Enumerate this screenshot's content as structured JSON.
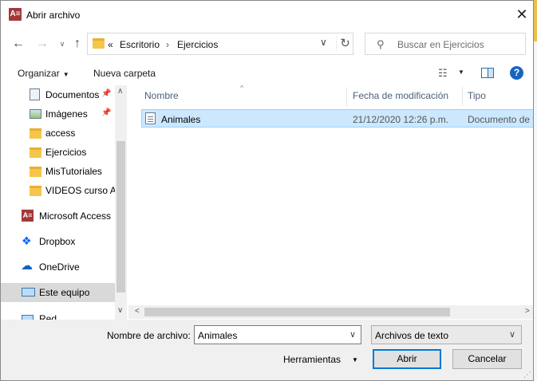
{
  "window": {
    "title": "Abrir archivo",
    "app_icon_text": "A≡",
    "close_glyph": "✕"
  },
  "address_bar": {
    "back_glyph": "←",
    "forward_glyph": "→",
    "recent_glyph": "∨",
    "up_glyph": "↑",
    "overflow": "«",
    "segments": [
      "Escritorio",
      "Ejercicios"
    ],
    "separator": "›",
    "dropdown_glyph": "∨",
    "refresh_glyph": "↻"
  },
  "search": {
    "icon_glyph": "⚲",
    "placeholder": "Buscar en Ejercicios"
  },
  "toolbar": {
    "organize": "Organizar",
    "organize_caret": "▼",
    "new_folder": "Nueva carpeta",
    "view_glyph": "☷",
    "view_caret": "▼",
    "help_glyph": "?"
  },
  "nav_pane": {
    "pin_glyph": "📌",
    "items": [
      {
        "label": "Documentos",
        "icon": "document-icon",
        "pinned": true
      },
      {
        "label": "Imágenes",
        "icon": "pictures-icon",
        "pinned": true
      },
      {
        "label": "access",
        "icon": "folder-icon"
      },
      {
        "label": "Ejercicios",
        "icon": "folder-icon"
      },
      {
        "label": "MisTutoriales",
        "icon": "folder-icon"
      },
      {
        "label": "VIDEOS curso Ac",
        "icon": "folder-icon"
      },
      {
        "label": "Microsoft Access",
        "icon": "access-icon",
        "icon_text": "A≡"
      },
      {
        "label": "Dropbox",
        "icon": "dropbox-icon",
        "icon_text": "❖"
      },
      {
        "label": "OneDrive",
        "icon": "onedrive-icon",
        "icon_text": "☁"
      },
      {
        "label": "Este equipo",
        "icon": "computer-icon",
        "selected": true
      },
      {
        "label": "Red",
        "icon": "network-icon"
      }
    ],
    "scroll_up": "∧",
    "scroll_down": "∨"
  },
  "file_list": {
    "sort_glyph": "^",
    "columns": [
      "Nombre",
      "Fecha de modificación",
      "Tipo"
    ],
    "rows": [
      {
        "name": "Animales",
        "modified": "21/12/2020 12:26 p.m.",
        "type": "Documento de t"
      }
    ],
    "scroll_left": "<",
    "scroll_right": ">"
  },
  "footer": {
    "filename_label": "Nombre de archivo:",
    "filename_value": "Animales",
    "filename_chevron": "∨",
    "filetype_value": "Archivos de texto",
    "filetype_chevron": "∨",
    "tools_label": "Herramientas",
    "tools_caret": "▼",
    "open_label": "Abrir",
    "cancel_label": "Cancelar",
    "grip_glyph": "⋰"
  },
  "colors": {
    "selection_bg": "#cce8ff",
    "selection_border": "#99d1ff",
    "accent": "#0078d7",
    "access_red": "#a4373a",
    "folder_yellow": "#f5c64b"
  }
}
